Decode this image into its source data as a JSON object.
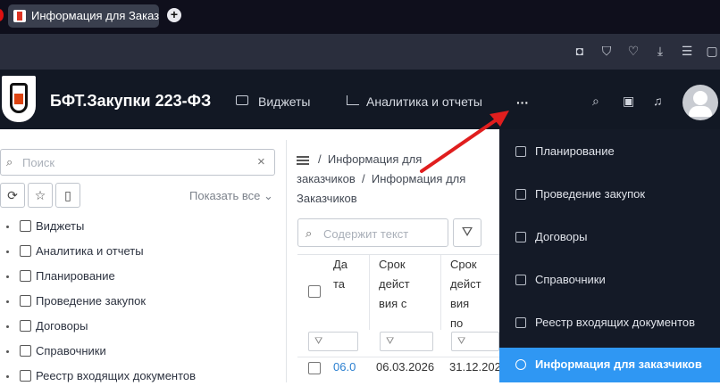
{
  "browser": {
    "tab_title": "Информация для Заказчи",
    "new_tab": "+"
  },
  "header": {
    "app_title": "БФТ.Закупки 223-ФЗ",
    "nav": [
      {
        "label": "Виджеты",
        "icon": "play-icon"
      },
      {
        "label": "Аналитика и отчеты",
        "icon": "chart-icon"
      }
    ],
    "more": "···",
    "icons": [
      "search-icon",
      "archive-icon",
      "bell-icon",
      "avatar"
    ]
  },
  "sidebar": {
    "search_placeholder": "Поиск",
    "show_all": "Показать все",
    "items": [
      {
        "label": "Виджеты"
      },
      {
        "label": "Аналитика и отчеты"
      },
      {
        "label": "Планирование"
      },
      {
        "label": "Проведение закупок"
      },
      {
        "label": "Договоры"
      },
      {
        "label": "Справочники"
      },
      {
        "label": "Реестр входящих документов"
      }
    ]
  },
  "main": {
    "breadcrumb": {
      "part1": "Информация для заказчиков",
      "separator": "/",
      "part2": "Информация для Заказчиков"
    },
    "search_placeholder": "Содержит текст",
    "table": {
      "headers": [
        "Дата",
        "Срок действия с",
        "Срок действия по"
      ],
      "header_lines": [
        [
          "Да",
          "та"
        ],
        [
          "Срок",
          "дейст",
          "вия с"
        ],
        [
          "Срок",
          "дейст",
          "вия",
          "по"
        ]
      ],
      "row": [
        "06.0",
        "06.03.2026",
        "31.12.202"
      ]
    }
  },
  "dropdown": {
    "items": [
      {
        "label": "Планирование"
      },
      {
        "label": "Проведение закупок"
      },
      {
        "label": "Договоры"
      },
      {
        "label": "Справочники"
      },
      {
        "label": "Реестр входящих документов"
      },
      {
        "label": "Информация для заказчиков"
      }
    ],
    "active_color": "#2f97f3"
  }
}
